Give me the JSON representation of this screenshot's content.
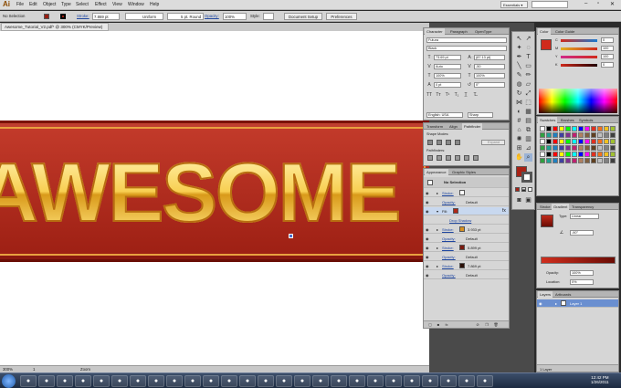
{
  "app": {
    "logo": "Ai"
  },
  "menu": [
    "File",
    "Edit",
    "Object",
    "Type",
    "Select",
    "Effect",
    "View",
    "Window",
    "Help"
  ],
  "workspace": {
    "label": "Essentials ▾"
  },
  "control_bar": {
    "selection": "No Selection",
    "stroke_label": "Stroke:",
    "stroke_value": "7.869 pt",
    "profile": "Uniform",
    "brush": "5 pt. Round",
    "opacity_label": "Opacity:",
    "opacity_value": "100%",
    "style_label": "Style:",
    "document_setup": "Document Setup",
    "preferences": "Preferences"
  },
  "document": {
    "tab_title": "Awesome_Tutorial_V2.pdf* @ 300% (CMYK/Preview)",
    "artwork_text": "AWESOME"
  },
  "status_bar": {
    "zoom": "300%",
    "page": "1",
    "tool": "Zoom"
  },
  "character_panel": {
    "tabs": [
      "Character",
      "Paragraph",
      "OpenType"
    ],
    "font": "Futura",
    "style": "Black",
    "size": "73.69 pt",
    "leading": "(87.13 pt)",
    "kerning": "Auto",
    "tracking": "-50",
    "horizontal_scale": "100%",
    "vertical_scale": "100%",
    "baseline": "0 pt",
    "rotation": "0°",
    "language": "English: USA",
    "aa": "Sharp"
  },
  "pathfinder_panel": {
    "tabs": [
      "Transform",
      "Align",
      "Pathfinder"
    ],
    "shape_modes": "Shape Modes:",
    "pathfinders": "Pathfinders:",
    "expand": "Expand"
  },
  "appearance_panel": {
    "tabs": [
      "Appearance",
      "Graphic Styles"
    ],
    "header": "No Selection",
    "rows": [
      {
        "label": "Stroke:",
        "value": ""
      },
      {
        "label": "Opacity:",
        "value": "Default"
      },
      {
        "label": "Fill:",
        "value": ""
      },
      {
        "label": "Drop Shadow",
        "value": ""
      },
      {
        "label": "Stroke:",
        "value": "3.933 pt"
      },
      {
        "label": "Opacity:",
        "value": "Default"
      },
      {
        "label": "Stroke:",
        "value": "5.899 pt"
      },
      {
        "label": "Opacity:",
        "value": "Default"
      },
      {
        "label": "Stroke:",
        "value": "7.869 pt"
      },
      {
        "label": "Opacity:",
        "value": "Default"
      }
    ]
  },
  "color_panel": {
    "tabs": [
      "Color",
      "Color Guide"
    ],
    "channels": [
      {
        "label": "C",
        "value": "0"
      },
      {
        "label": "M",
        "value": "100"
      },
      {
        "label": "Y",
        "value": "100"
      },
      {
        "label": "K",
        "value": "0"
      }
    ]
  },
  "swatches_panel": {
    "tabs": [
      "Swatches",
      "Brushes",
      "Symbols"
    ]
  },
  "gradient_panel": {
    "tabs": [
      "Stroke",
      "Gradient",
      "Transparency"
    ],
    "type_label": "Type:",
    "type": "Linear",
    "angle": "-90°",
    "opacity_label": "Opacity:",
    "opacity": "100%",
    "location_label": "Location:",
    "location": "0%"
  },
  "layers_panel": {
    "tabs": [
      "Layers",
      "Artboards"
    ],
    "layer": "Layer 1",
    "footer": "1 Layer"
  },
  "taskbar": {
    "time": "12:42 PM",
    "date": "1/26/2011"
  },
  "colors": {
    "accent_red": "#c03020",
    "artwork_gold": "#f3b640"
  }
}
